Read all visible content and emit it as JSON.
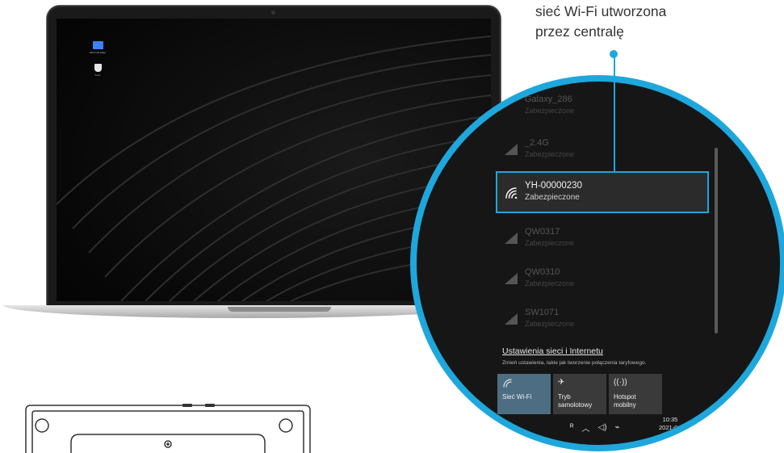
{
  "callout": {
    "line1": "sieć Wi-Fi utworzona",
    "line2": "przez centralę"
  },
  "desktop": {
    "icons": [
      {
        "name": "Microsoft Edge",
        "icon": "monitor-icon",
        "color": "#3b82f6"
      },
      {
        "name": "Kosz",
        "icon": "recycle-bin-icon",
        "color": "#e6e6e6"
      }
    ]
  },
  "wifi_panel": {
    "networks": [
      {
        "name": "Galaxy_286",
        "status": "Zabezpieczone",
        "selected": false
      },
      {
        "name": "_2.4G",
        "status": "Zabezpieczone",
        "selected": false
      },
      {
        "name": "YH-00000230",
        "status": "Zabezpieczone",
        "selected": true
      },
      {
        "name": "QW0317",
        "status": "Zabezpieczone",
        "selected": false
      },
      {
        "name": "QW0310",
        "status": "Zabezpieczone",
        "selected": false
      },
      {
        "name": "SW1071",
        "status": "Zabezpieczone",
        "selected": false
      }
    ],
    "settings_link": "Ustawienia sieci i Internetu",
    "settings_desc": "Zmień ustawienia, takie jak tworzenie połączenia taryfowego.",
    "tiles": [
      {
        "label": "Sieć Wi-Fi",
        "icon": "wifi-icon",
        "active": true
      },
      {
        "label": "Tryb\nsamolotowy",
        "icon": "airplane-icon",
        "active": false
      },
      {
        "label": "Hotspot\nmobilny",
        "icon": "hotspot-icon",
        "active": false
      }
    ],
    "tray": {
      "time": "10:35",
      "date": "2021-0"
    }
  },
  "colors": {
    "accent": "#1ea7dc",
    "selected_row_bg": "#2b2b2b",
    "active_tile_bg": "#4d6e82"
  }
}
